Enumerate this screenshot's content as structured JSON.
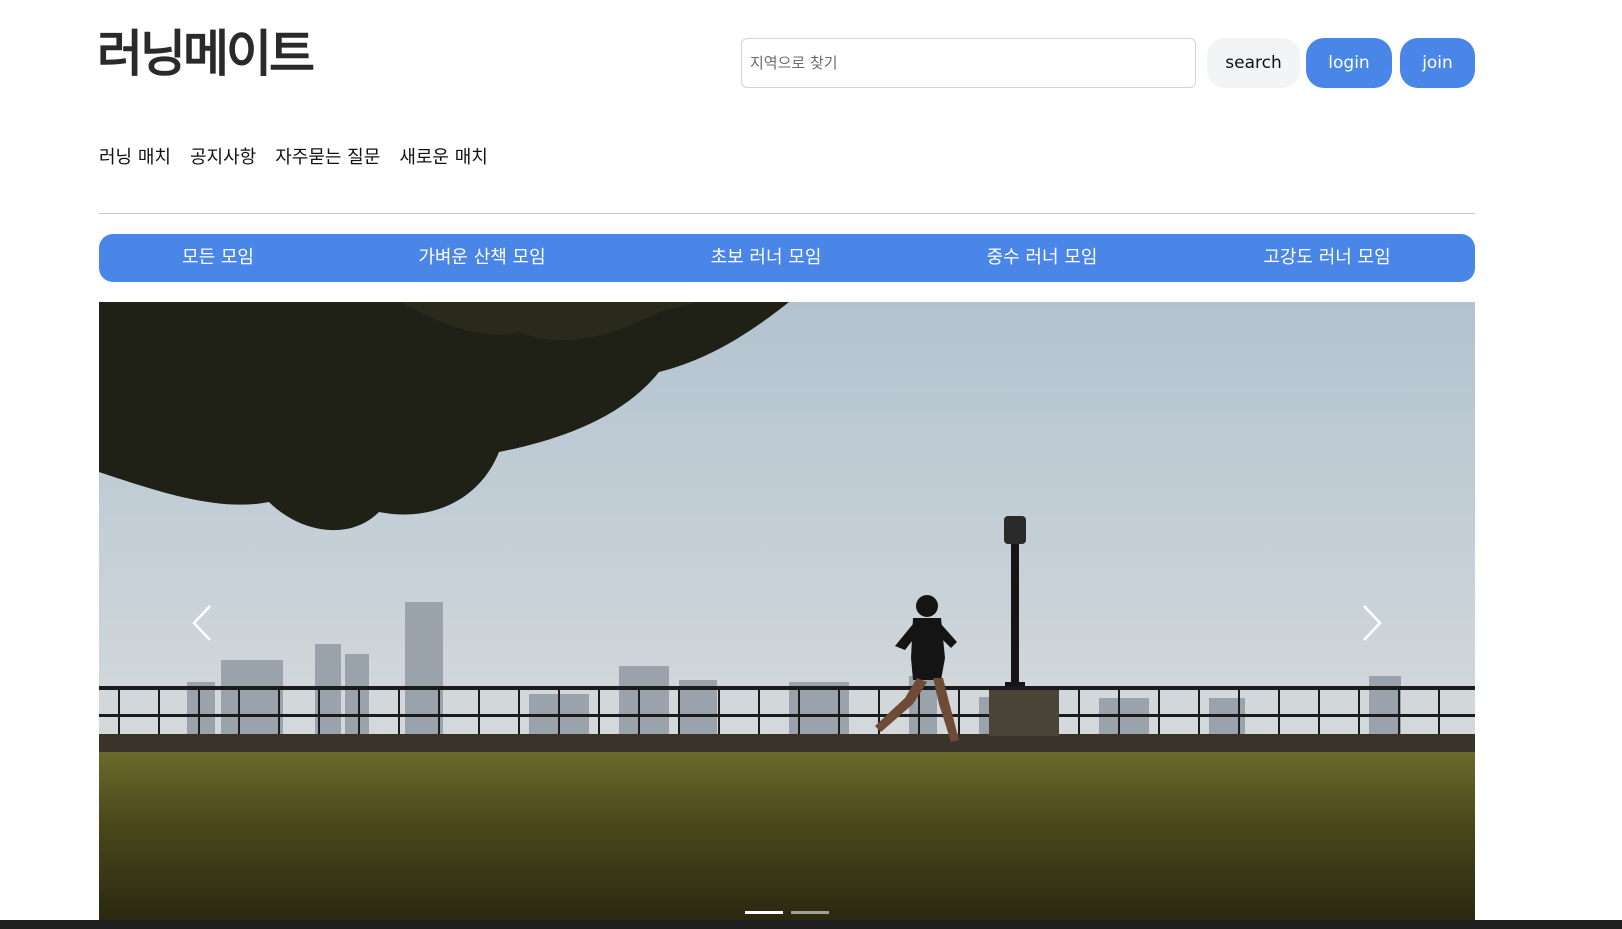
{
  "header": {
    "logo_text": "러닝메이트",
    "search": {
      "placeholder": "지역으로 찾기",
      "value": ""
    },
    "search_label": "search",
    "login_label": "login",
    "join_label": "join"
  },
  "nav": {
    "items": [
      {
        "label": "러닝 매치"
      },
      {
        "label": "공지사항"
      },
      {
        "label": "자주묻는 질문"
      },
      {
        "label": "새로운 매치"
      }
    ]
  },
  "categories": {
    "items": [
      {
        "label": "모든 모임"
      },
      {
        "label": "가벼운 산책 모임"
      },
      {
        "label": "초보 러너 모임"
      },
      {
        "label": "중수 러너 모임"
      },
      {
        "label": "고강도 러너 모임"
      }
    ]
  },
  "carousel": {
    "image_subject": "runner on riverside lawn with city skyline",
    "prev_icon": "chevron-left-icon",
    "next_icon": "chevron-right-icon",
    "slide_count": 2,
    "active_slide": 1
  },
  "colors": {
    "accent": "#4a86e8",
    "search_button_bg": "#f3f4f6",
    "divider": "#c8c8c8"
  }
}
